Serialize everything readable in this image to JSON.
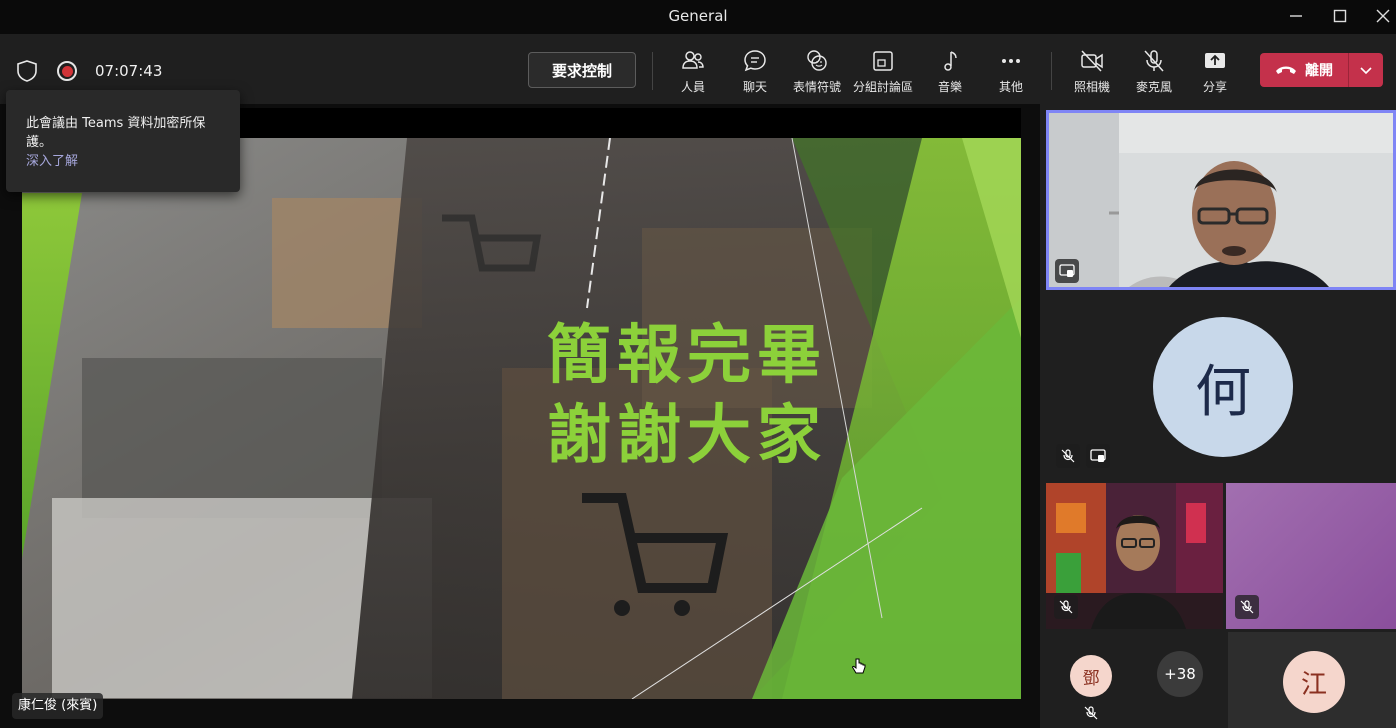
{
  "window": {
    "title": "General"
  },
  "toolbar": {
    "timer": "07:07:43",
    "request_control": "要求控制",
    "people": "人員",
    "chat": "聊天",
    "reactions": "表情符號",
    "breakout_rooms": "分組討論區",
    "music": "音樂",
    "more": "其他",
    "camera": "照相機",
    "mic": "麥克風",
    "share": "分享",
    "leave": "離開"
  },
  "tooltip": {
    "text": "此會議由 Teams 資料加密所保護。",
    "link": "深入了解"
  },
  "slide": {
    "line1": "簡報完畢",
    "line2": "謝謝大家",
    "text_color": "#8cd13a"
  },
  "presenter": {
    "name": "康仁俊 (來賓)"
  },
  "gallery": {
    "avatar_he": "何",
    "avatar_deng": "鄧",
    "overflow_count": "+38",
    "avatar_jiang": "江"
  },
  "colors": {
    "leave": "#c4314b",
    "active_speaker": "#7f85f5",
    "record": "#d13438"
  }
}
